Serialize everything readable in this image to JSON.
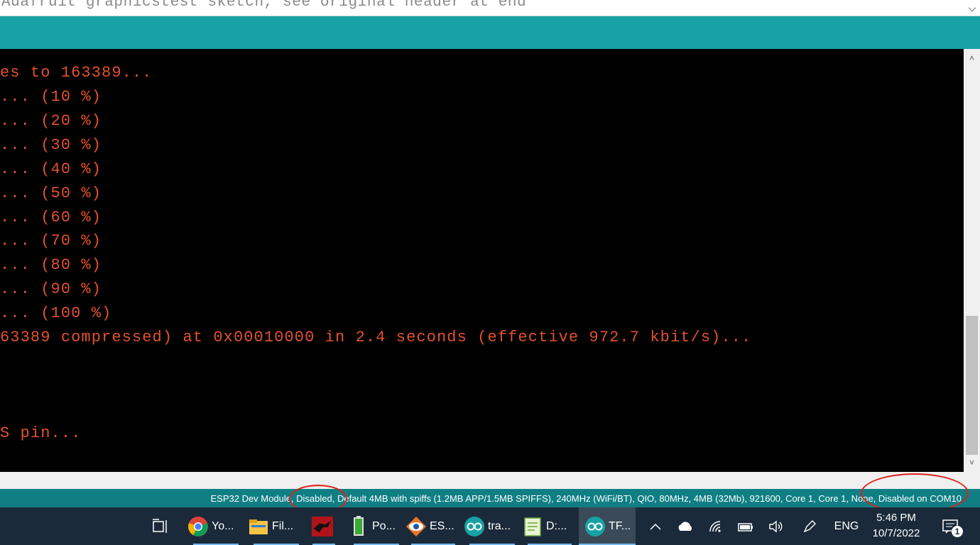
{
  "editor": {
    "line_text": "Adafruit graphicstest sketch, see original header at end"
  },
  "console": {
    "lines": [
      "es to 163389...",
      "... (10 %)",
      "... (20 %)",
      "... (30 %)",
      "... (40 %)",
      "... (50 %)",
      "... (60 %)",
      "... (70 %)",
      "... (80 %)",
      "... (90 %)",
      "... (100 %)",
      "63389 compressed) at 0x00010000 in 2.4 seconds (effective 972.7 kbit/s)...",
      "",
      "",
      "",
      "S pin..."
    ]
  },
  "status_bar": {
    "text": "ESP32 Dev Module, Disabled, Default 4MB with spiffs (1.2MB APP/1.5MB SPIFFS), 240MHz (WiFi/BT), QIO, 80MHz, 4MB (32Mb), 921600, Core 1, Core 1, None, Disabled on COM10"
  },
  "taskbar": {
    "items": [
      {
        "label": "Yo...",
        "icon": "chrome-icon"
      },
      {
        "label": "Fil...",
        "icon": "file-explorer-icon"
      },
      {
        "label": "",
        "icon": "dragon-app-icon"
      },
      {
        "label": "Po...",
        "icon": "power-app-icon"
      },
      {
        "label": "ES...",
        "icon": "eye-app-icon"
      },
      {
        "label": "tra...",
        "icon": "arduino-icon"
      },
      {
        "label": "D:...",
        "icon": "notepad-plus-icon"
      },
      {
        "label": "TF...",
        "icon": "arduino-icon"
      }
    ],
    "language": "ENG",
    "time": "5:46 PM",
    "date": "10/7/2022",
    "notification_count": "1"
  },
  "colors": {
    "teal": "#17a1a5",
    "status_teal": "#0f7f84",
    "console_text": "#e2522b",
    "taskbar_bg": "#1b2a3a"
  }
}
